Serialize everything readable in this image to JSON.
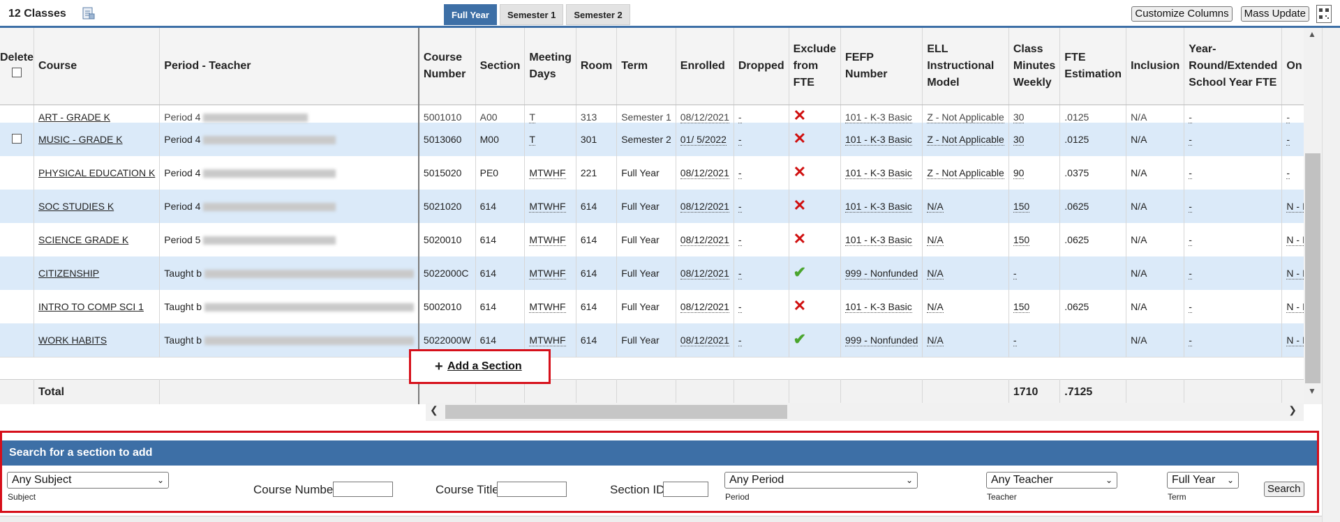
{
  "header": {
    "classes_title": "12 Classes",
    "tabs": [
      "Full Year",
      "Semester 1",
      "Semester 2"
    ],
    "active_tab": "Full Year",
    "customize_columns": "Customize Columns",
    "mass_update": "Mass Update"
  },
  "columns": [
    "Delete",
    "Course",
    "Period - Teacher",
    "Course Number",
    "Section",
    "Meeting Days",
    "Room",
    "Term",
    "Enrolled",
    "Dropped",
    "Exclude from FTE",
    "FEFP Number",
    "ELL Instructional Model",
    "Class Minutes Weekly",
    "FTE Estimation",
    "Inclusion",
    "Year-Round/Extended School Year FTE",
    "On"
  ],
  "partial_row": {
    "course": "ART - GRADE K",
    "teacher": "Period 4",
    "course_number": "5001010",
    "section": "A00",
    "days": "T",
    "room": "313",
    "term": "Semester 1",
    "enrolled": "08/12/2021",
    "dropped": "-",
    "fefp": "101 - K-3 Basic",
    "ell": "Z - Not Applicable",
    "minutes": "30",
    "fte": ".0125",
    "inclusion": "N/A",
    "yr": "-",
    "on": "-"
  },
  "rows": [
    {
      "course": "MUSIC - GRADE K",
      "teacher": "Period 4",
      "course_number": "5013060",
      "section": "M00",
      "days": "T",
      "room": "301",
      "term": "Semester 2",
      "enrolled": "01/ 5/2022",
      "dropped": "-",
      "exclude": "x",
      "fefp": "101 - K-3 Basic",
      "ell": "Z - Not Applicable",
      "minutes": "30",
      "fte": ".0125",
      "inclusion": "N/A",
      "yr": "-",
      "on": "-"
    },
    {
      "course": "PHYSICAL EDUCATION K",
      "teacher": "Period 4",
      "course_number": "5015020",
      "section": "PE0",
      "days": "MTWHF",
      "room": "221",
      "term": "Full Year",
      "enrolled": "08/12/2021",
      "dropped": "-",
      "exclude": "x",
      "fefp": "101 - K-3 Basic",
      "ell": "Z - Not Applicable",
      "minutes": "90",
      "fte": ".0375",
      "inclusion": "N/A",
      "yr": "-",
      "on": "-"
    },
    {
      "course": "SOC STUDIES K",
      "teacher": "Period 4",
      "course_number": "5021020",
      "section": "614",
      "days": "MTWHF",
      "room": "614",
      "term": "Full Year",
      "enrolled": "08/12/2021",
      "dropped": "-",
      "exclude": "x",
      "fefp": "101 - K-3 Basic",
      "ell": "N/A",
      "minutes": "150",
      "fte": ".0625",
      "inclusion": "N/A",
      "yr": "-",
      "on": "N - I"
    },
    {
      "course": "SCIENCE GRADE K",
      "teacher": "Period 5",
      "course_number": "5020010",
      "section": "614",
      "days": "MTWHF",
      "room": "614",
      "term": "Full Year",
      "enrolled": "08/12/2021",
      "dropped": "-",
      "exclude": "x",
      "fefp": "101 - K-3 Basic",
      "ell": "N/A",
      "minutes": "150",
      "fte": ".0625",
      "inclusion": "N/A",
      "yr": "-",
      "on": "N - I"
    },
    {
      "course": "CITIZENSHIP",
      "teacher": "Taught b",
      "course_number": "5022000C",
      "section": "614",
      "days": "MTWHF",
      "room": "614",
      "term": "Full Year",
      "enrolled": "08/12/2021",
      "dropped": "-",
      "exclude": "check",
      "fefp": "999 - Nonfunded",
      "ell": "N/A",
      "minutes": "-",
      "fte": "",
      "inclusion": "N/A",
      "yr": "-",
      "on": "N - I"
    },
    {
      "course": "INTRO TO COMP SCI 1",
      "teacher": "Taught b",
      "course_number": "5002010",
      "section": "614",
      "days": "MTWHF",
      "room": "614",
      "term": "Full Year",
      "enrolled": "08/12/2021",
      "dropped": "-",
      "exclude": "x",
      "fefp": "101 - K-3 Basic",
      "ell": "N/A",
      "minutes": "150",
      "fte": ".0625",
      "inclusion": "N/A",
      "yr": "-",
      "on": "N - I"
    },
    {
      "course": "WORK HABITS",
      "teacher": "Taught b",
      "course_number": "5022000W",
      "section": "614",
      "days": "MTWHF",
      "room": "614",
      "term": "Full Year",
      "enrolled": "08/12/2021",
      "dropped": "-",
      "exclude": "check",
      "fefp": "999 - Nonfunded",
      "ell": "N/A",
      "minutes": "-",
      "fte": "",
      "inclusion": "N/A",
      "yr": "-",
      "on": "N - I"
    }
  ],
  "add_section": {
    "plus": "+",
    "label": "Add a Section"
  },
  "total": {
    "label": "Total",
    "minutes": "1710",
    "fte": ".7125"
  },
  "search": {
    "header": "Search for a section to add",
    "subject": {
      "value": "Any Subject",
      "caption": "Subject"
    },
    "course_number_label": "Course Number",
    "course_title_label": "Course Title",
    "section_id_label": "Section ID",
    "period": {
      "value": "Any Period",
      "caption": "Period"
    },
    "teacher": {
      "value": "Any Teacher",
      "caption": "Teacher"
    },
    "term": {
      "value": "Full Year",
      "caption": "Term"
    },
    "button": "Search"
  },
  "colors": {
    "accent": "#3d6fa6",
    "row_alt": "#dbeaf9",
    "highlight": "#d60f1a",
    "x_mark": "#d01010",
    "check_mark": "#4aa52e"
  }
}
